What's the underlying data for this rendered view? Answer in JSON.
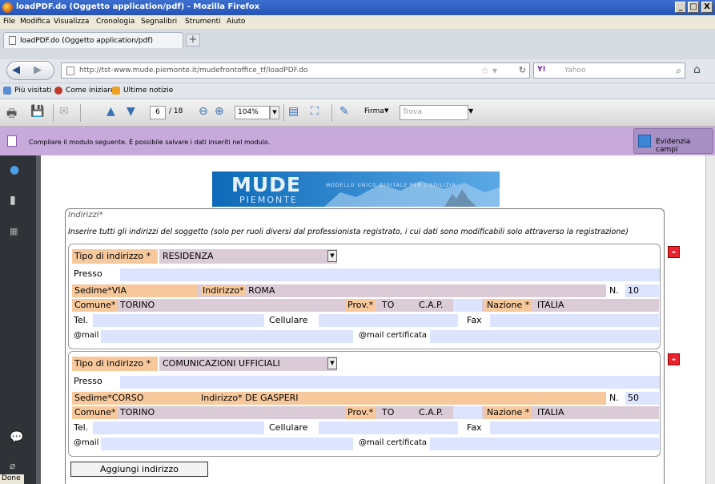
{
  "window": {
    "title": "loadPDF.do (Oggetto application/pdf) - Mozilla Firefox",
    "min": "_",
    "max": "□",
    "close": "X"
  },
  "menu": [
    "File",
    "Modifica",
    "Visualizza",
    "Cronologia",
    "Segnalibri",
    "Strumenti",
    "Aiuto"
  ],
  "tab": {
    "label": "loadPDF.do (Oggetto application/pdf)",
    "new": "+"
  },
  "nav": {
    "url": "http://tst-www.mude.piemonte.it/mudefrontoffice_tf/loadPDF.do",
    "search_brand": "Y!",
    "search_placeholder": "Yahoo"
  },
  "bookmarks": [
    "Più visitati",
    "Come iniziare",
    "Ultime notizie"
  ],
  "pdf": {
    "page": "6",
    "of": "/ 18",
    "zoom": "104%",
    "firma": "Firma",
    "trova": "Trova"
  },
  "info": {
    "message": "Compilare il modulo seguente. È possibile salvare i dati inseriti nel modulo.",
    "highlight": "Evidenzia campi"
  },
  "status": "Done",
  "banner": {
    "line1": "MUDE",
    "line2": "PIEMONTE",
    "tagline": "MODELLO UNICO DIGITALE PER L'EDILIZIA"
  },
  "form": {
    "title": "Indirizzi*",
    "desc": "Inserire tutti gli indirizzi del soggetto (solo per ruoli diversi dal professionista registrato, i cui dati sono modificabili solo attraverso la registrazione)",
    "labels": {
      "tipo": "Tipo di indirizzo *",
      "presso": "Presso",
      "sedime": "Sedime*",
      "indirizzo": "Indirizzo*",
      "n": "N.",
      "comune": "Comune*",
      "prov": "Prov.*",
      "cap": "C.A.P.",
      "nazione": "Nazione *",
      "tel": "Tel.",
      "cell": "Cellulare",
      "fax": "Fax",
      "mail": "@mail",
      "pec": "@mail certificata"
    },
    "addresses": [
      {
        "tipo": "RESIDENZA",
        "sedime": "VIA",
        "indirizzo": "ROMA",
        "n": "10",
        "comune": "TORINO",
        "prov": "TO",
        "nazione": "ITALIA"
      },
      {
        "tipo": "COMUNICAZIONI UFFICIALI",
        "sedime": "CORSO",
        "indirizzo": "DE GASPERI",
        "n": "50",
        "comune": "TORINO",
        "prov": "TO",
        "nazione": "ITALIA"
      }
    ],
    "add_button": "Aggiungi indirizzo",
    "remove": "-"
  }
}
